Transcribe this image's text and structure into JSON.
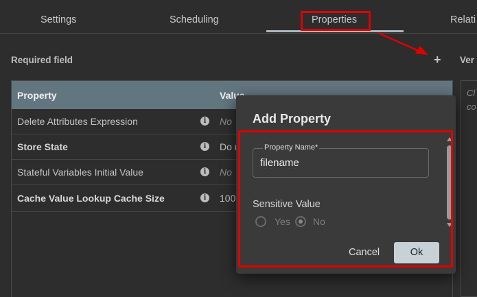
{
  "tabs": [
    {
      "label": "Settings"
    },
    {
      "label": "Scheduling"
    },
    {
      "label": "Properties"
    },
    {
      "label": "Relati"
    }
  ],
  "section": {
    "required_label": "Required field",
    "add_icon": "plus-icon",
    "right_label": "Ver"
  },
  "table": {
    "headers": [
      "Property",
      "Value"
    ],
    "rows": [
      {
        "name": "Delete Attributes Expression",
        "value": "No"
      },
      {
        "name": "Store State",
        "value": "Do n"
      },
      {
        "name": "Stateful Variables Initial Value",
        "value": "No"
      },
      {
        "name": "Cache Value Lookup Cache Size",
        "value": "100"
      }
    ],
    "info_icon": "info-icon"
  },
  "side_panel": {
    "line1": "Cl",
    "line2": "co"
  },
  "dialog": {
    "title": "Add Property",
    "field_label": "Property Name*",
    "field_value": "filename",
    "sensitive_label": "Sensitive Value",
    "options": [
      "Yes",
      "No"
    ],
    "selected": "No",
    "cancel_label": "Cancel",
    "ok_label": "Ok"
  },
  "colors": {
    "highlight": "#e00000",
    "table_header": "#627680",
    "background": "#2d2d2d",
    "dialog": "#3a3a3a"
  }
}
